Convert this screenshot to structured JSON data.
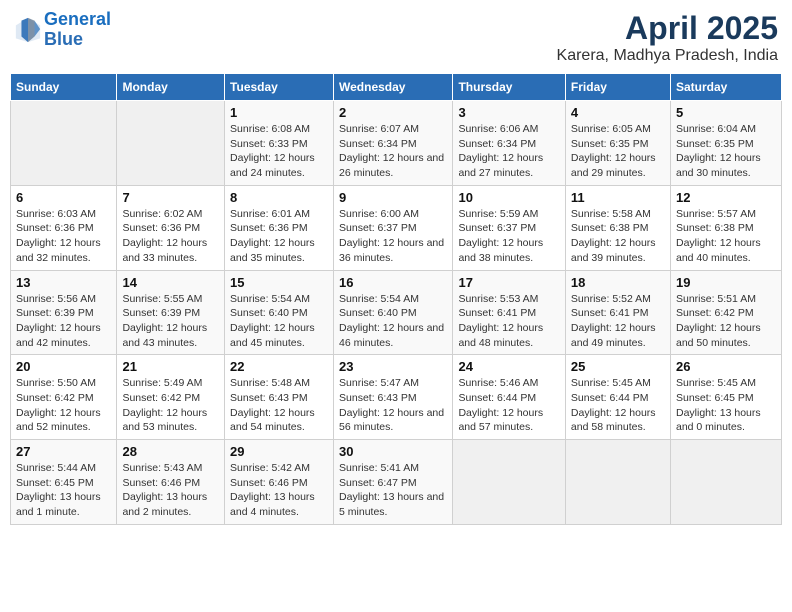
{
  "logo": {
    "line1": "General",
    "line2": "Blue"
  },
  "title": "April 2025",
  "subtitle": "Karera, Madhya Pradesh, India",
  "days_of_week": [
    "Sunday",
    "Monday",
    "Tuesday",
    "Wednesday",
    "Thursday",
    "Friday",
    "Saturday"
  ],
  "weeks": [
    [
      {
        "day": "",
        "empty": true
      },
      {
        "day": "",
        "empty": true
      },
      {
        "day": "1",
        "sunrise": "Sunrise: 6:08 AM",
        "sunset": "Sunset: 6:33 PM",
        "daylight": "Daylight: 12 hours and 24 minutes."
      },
      {
        "day": "2",
        "sunrise": "Sunrise: 6:07 AM",
        "sunset": "Sunset: 6:34 PM",
        "daylight": "Daylight: 12 hours and 26 minutes."
      },
      {
        "day": "3",
        "sunrise": "Sunrise: 6:06 AM",
        "sunset": "Sunset: 6:34 PM",
        "daylight": "Daylight: 12 hours and 27 minutes."
      },
      {
        "day": "4",
        "sunrise": "Sunrise: 6:05 AM",
        "sunset": "Sunset: 6:35 PM",
        "daylight": "Daylight: 12 hours and 29 minutes."
      },
      {
        "day": "5",
        "sunrise": "Sunrise: 6:04 AM",
        "sunset": "Sunset: 6:35 PM",
        "daylight": "Daylight: 12 hours and 30 minutes."
      }
    ],
    [
      {
        "day": "6",
        "sunrise": "Sunrise: 6:03 AM",
        "sunset": "Sunset: 6:36 PM",
        "daylight": "Daylight: 12 hours and 32 minutes."
      },
      {
        "day": "7",
        "sunrise": "Sunrise: 6:02 AM",
        "sunset": "Sunset: 6:36 PM",
        "daylight": "Daylight: 12 hours and 33 minutes."
      },
      {
        "day": "8",
        "sunrise": "Sunrise: 6:01 AM",
        "sunset": "Sunset: 6:36 PM",
        "daylight": "Daylight: 12 hours and 35 minutes."
      },
      {
        "day": "9",
        "sunrise": "Sunrise: 6:00 AM",
        "sunset": "Sunset: 6:37 PM",
        "daylight": "Daylight: 12 hours and 36 minutes."
      },
      {
        "day": "10",
        "sunrise": "Sunrise: 5:59 AM",
        "sunset": "Sunset: 6:37 PM",
        "daylight": "Daylight: 12 hours and 38 minutes."
      },
      {
        "day": "11",
        "sunrise": "Sunrise: 5:58 AM",
        "sunset": "Sunset: 6:38 PM",
        "daylight": "Daylight: 12 hours and 39 minutes."
      },
      {
        "day": "12",
        "sunrise": "Sunrise: 5:57 AM",
        "sunset": "Sunset: 6:38 PM",
        "daylight": "Daylight: 12 hours and 40 minutes."
      }
    ],
    [
      {
        "day": "13",
        "sunrise": "Sunrise: 5:56 AM",
        "sunset": "Sunset: 6:39 PM",
        "daylight": "Daylight: 12 hours and 42 minutes."
      },
      {
        "day": "14",
        "sunrise": "Sunrise: 5:55 AM",
        "sunset": "Sunset: 6:39 PM",
        "daylight": "Daylight: 12 hours and 43 minutes."
      },
      {
        "day": "15",
        "sunrise": "Sunrise: 5:54 AM",
        "sunset": "Sunset: 6:40 PM",
        "daylight": "Daylight: 12 hours and 45 minutes."
      },
      {
        "day": "16",
        "sunrise": "Sunrise: 5:54 AM",
        "sunset": "Sunset: 6:40 PM",
        "daylight": "Daylight: 12 hours and 46 minutes."
      },
      {
        "day": "17",
        "sunrise": "Sunrise: 5:53 AM",
        "sunset": "Sunset: 6:41 PM",
        "daylight": "Daylight: 12 hours and 48 minutes."
      },
      {
        "day": "18",
        "sunrise": "Sunrise: 5:52 AM",
        "sunset": "Sunset: 6:41 PM",
        "daylight": "Daylight: 12 hours and 49 minutes."
      },
      {
        "day": "19",
        "sunrise": "Sunrise: 5:51 AM",
        "sunset": "Sunset: 6:42 PM",
        "daylight": "Daylight: 12 hours and 50 minutes."
      }
    ],
    [
      {
        "day": "20",
        "sunrise": "Sunrise: 5:50 AM",
        "sunset": "Sunset: 6:42 PM",
        "daylight": "Daylight: 12 hours and 52 minutes."
      },
      {
        "day": "21",
        "sunrise": "Sunrise: 5:49 AM",
        "sunset": "Sunset: 6:42 PM",
        "daylight": "Daylight: 12 hours and 53 minutes."
      },
      {
        "day": "22",
        "sunrise": "Sunrise: 5:48 AM",
        "sunset": "Sunset: 6:43 PM",
        "daylight": "Daylight: 12 hours and 54 minutes."
      },
      {
        "day": "23",
        "sunrise": "Sunrise: 5:47 AM",
        "sunset": "Sunset: 6:43 PM",
        "daylight": "Daylight: 12 hours and 56 minutes."
      },
      {
        "day": "24",
        "sunrise": "Sunrise: 5:46 AM",
        "sunset": "Sunset: 6:44 PM",
        "daylight": "Daylight: 12 hours and 57 minutes."
      },
      {
        "day": "25",
        "sunrise": "Sunrise: 5:45 AM",
        "sunset": "Sunset: 6:44 PM",
        "daylight": "Daylight: 12 hours and 58 minutes."
      },
      {
        "day": "26",
        "sunrise": "Sunrise: 5:45 AM",
        "sunset": "Sunset: 6:45 PM",
        "daylight": "Daylight: 13 hours and 0 minutes."
      }
    ],
    [
      {
        "day": "27",
        "sunrise": "Sunrise: 5:44 AM",
        "sunset": "Sunset: 6:45 PM",
        "daylight": "Daylight: 13 hours and 1 minute."
      },
      {
        "day": "28",
        "sunrise": "Sunrise: 5:43 AM",
        "sunset": "Sunset: 6:46 PM",
        "daylight": "Daylight: 13 hours and 2 minutes."
      },
      {
        "day": "29",
        "sunrise": "Sunrise: 5:42 AM",
        "sunset": "Sunset: 6:46 PM",
        "daylight": "Daylight: 13 hours and 4 minutes."
      },
      {
        "day": "30",
        "sunrise": "Sunrise: 5:41 AM",
        "sunset": "Sunset: 6:47 PM",
        "daylight": "Daylight: 13 hours and 5 minutes."
      },
      {
        "day": "",
        "empty": true
      },
      {
        "day": "",
        "empty": true
      },
      {
        "day": "",
        "empty": true
      }
    ]
  ]
}
